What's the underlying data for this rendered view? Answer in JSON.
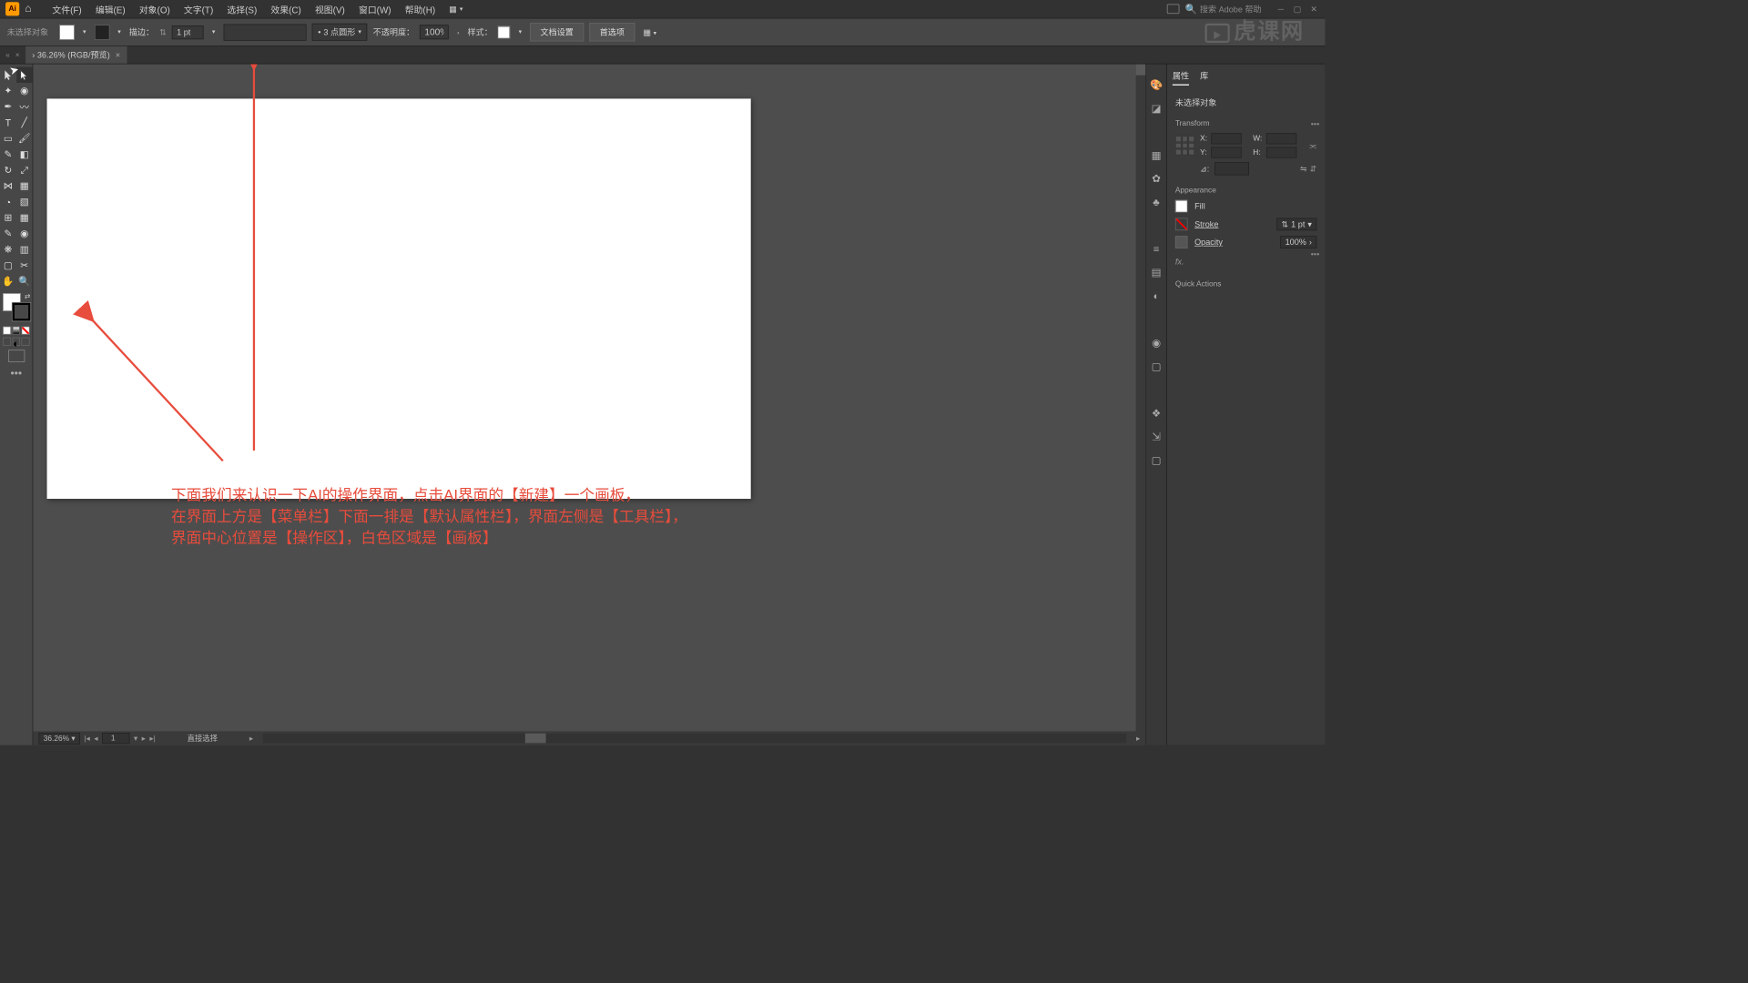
{
  "menubar": {
    "items": [
      "文件(F)",
      "编辑(E)",
      "对象(O)",
      "文字(T)",
      "选择(S)",
      "效果(C)",
      "视图(V)",
      "窗口(W)",
      "帮助(H)"
    ],
    "logo": "Ai",
    "search_placeholder": "搜索 Adobe 帮助"
  },
  "options": {
    "selection": "未选择对象",
    "stroke_label": "描边：",
    "stroke_weight": "1 pt",
    "brush_def": "3 点圆形",
    "opacity_label": "不透明度：",
    "opacity": "100%",
    "style_label": "样式：",
    "doc_setup": "文档设置",
    "prefs": "首选项"
  },
  "tab": {
    "title": "36.26% (RGB/预览)"
  },
  "status": {
    "zoom": "36.26%",
    "artboard": "1",
    "tool": "直接选择"
  },
  "props": {
    "tab_props": "属性",
    "tab_lib": "库",
    "no_sel": "未选择对象",
    "transform": "Transform",
    "x_lbl": "X:",
    "y_lbl": "Y:",
    "w_lbl": "W:",
    "h_lbl": "H:",
    "angle": "⊿:",
    "appearance": "Appearance",
    "fill": "Fill",
    "stroke": "Stroke",
    "stroke_val": "1 pt",
    "opacity": "Opacity",
    "opacity_val": "100%",
    "fx": "fx.",
    "quick": "Quick Actions"
  },
  "annotation": {
    "line1": "下面我们来认识一下AI的操作界面，点击AI界面的【新建】一个画板，",
    "line2": "在界面上方是【菜单栏】下面一排是【默认属性栏】，界面左侧是【工具栏】，",
    "line3": "界面中心位置是【操作区】，白色区域是【画板】"
  },
  "watermark": "虎课网"
}
